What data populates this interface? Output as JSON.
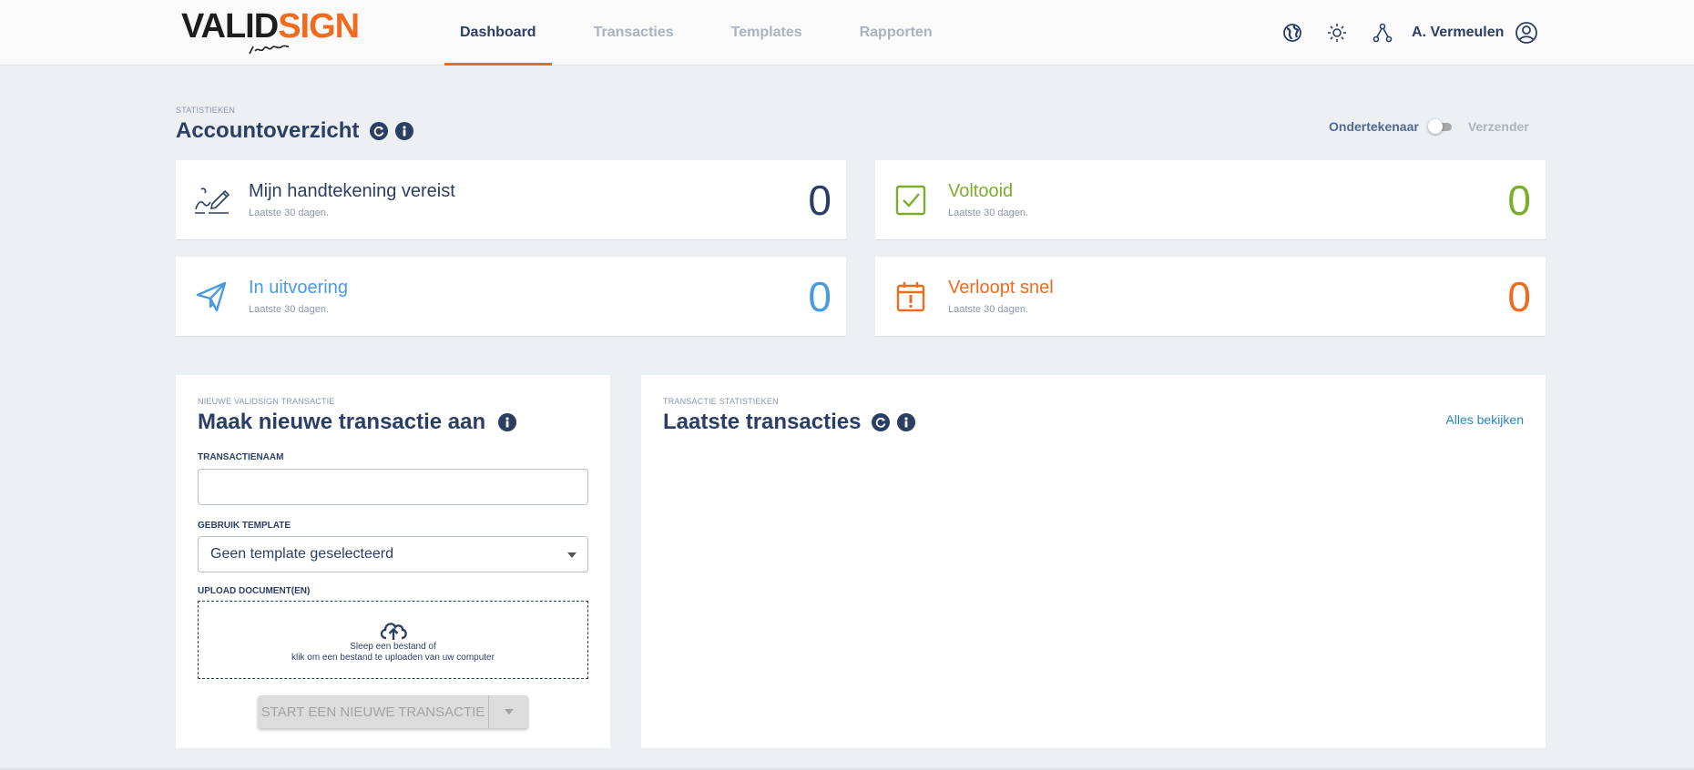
{
  "header": {
    "logo": {
      "part1": "VALID",
      "part2": "SIGN"
    },
    "nav": [
      {
        "label": "Dashboard",
        "active": true
      },
      {
        "label": "Transacties",
        "active": false
      },
      {
        "label": "Templates",
        "active": false
      },
      {
        "label": "Rapporten",
        "active": false
      }
    ],
    "tools": [
      "globe-icon",
      "sun-icon",
      "hierarchy-icon"
    ],
    "user_name": "A. Vermeulen"
  },
  "overview": {
    "eyebrow": "STATISTIEKEN",
    "title": "Accountoverzicht",
    "toggle": {
      "left_label": "Ondertekenaar",
      "right_label": "Verzender",
      "selected": "Ondertekenaar"
    }
  },
  "stats": [
    {
      "title": "Mijn handtekening vereist",
      "sub": "Laatste 30 dagen.",
      "count": "0",
      "color": "#2b3e63",
      "icon": "signature-icon"
    },
    {
      "title": "Voltooid",
      "sub": "Laatste 30 dagen.",
      "count": "0",
      "color": "#7cae2c",
      "icon": "checkbox-icon"
    },
    {
      "title": "In uitvoering",
      "sub": "Laatste 30 dagen.",
      "count": "0",
      "color": "#4a9ae0",
      "icon": "paper-plane-icon"
    },
    {
      "title": "Verloopt snel",
      "sub": "Laatste 30 dagen.",
      "count": "0",
      "color": "#ef6b1f",
      "icon": "calendar-alert-icon"
    }
  ],
  "new_transaction": {
    "eyebrow": "NIEUWE VALIDSIGN TRANSACTIE",
    "title": "Maak nieuwe transactie aan",
    "name_label": "TRANSACTIENAAM",
    "name_value": "",
    "template_label": "GEBRUIK TEMPLATE",
    "template_value": "Geen template geselecteerd",
    "upload_label": "UPLOAD DOCUMENT(EN)",
    "upload_line1": "Sleep een bestand of",
    "upload_line2": "klik om een bestand te uploaden van uw computer",
    "start_button": "START EEN NIEUWE TRANSACTIE"
  },
  "latest": {
    "eyebrow": "TRANSACTIE STATISTIEKEN",
    "title": "Laatste transacties",
    "view_all": "Alles bekijken"
  },
  "colors": {
    "accent": "#ef6b1f",
    "navy": "#2b3e63",
    "link": "#2b86c4",
    "background": "#edf0f3"
  }
}
